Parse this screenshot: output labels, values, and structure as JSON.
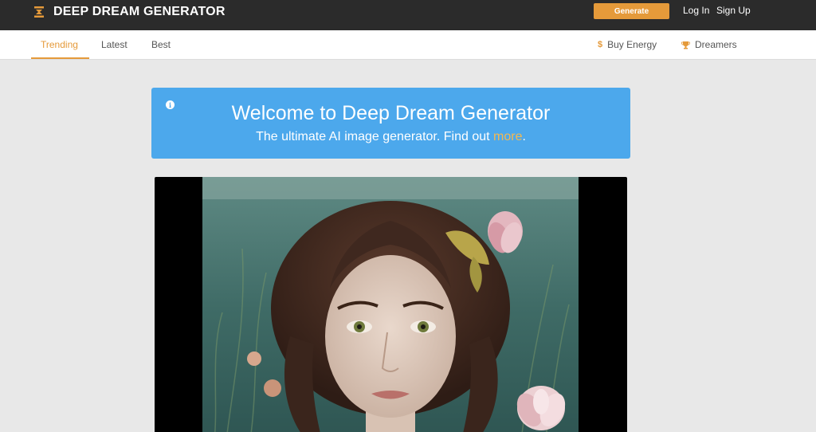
{
  "header": {
    "brand": "DEEP DREAM GENERATOR",
    "generate_label": "Generate",
    "login_label": "Log In",
    "signup_label": "Sign Up",
    "accent_color": "#e59a3a"
  },
  "subnav": {
    "tabs": [
      {
        "label": "Trending",
        "active": true
      },
      {
        "label": "Latest",
        "active": false
      },
      {
        "label": "Best",
        "active": false
      }
    ],
    "buy_energy_label": "Buy Energy",
    "dreamers_label": "Dreamers"
  },
  "banner": {
    "title": "Welcome to Deep Dream Generator",
    "subtitle_prefix": "The ultimate AI image generator. Find out ",
    "subtitle_link": "more",
    "subtitle_suffix": ".",
    "color": "#4ca8ec"
  },
  "feed": {
    "items": [
      {
        "subject": "woman-portrait-with-lotus-flowers"
      }
    ]
  }
}
